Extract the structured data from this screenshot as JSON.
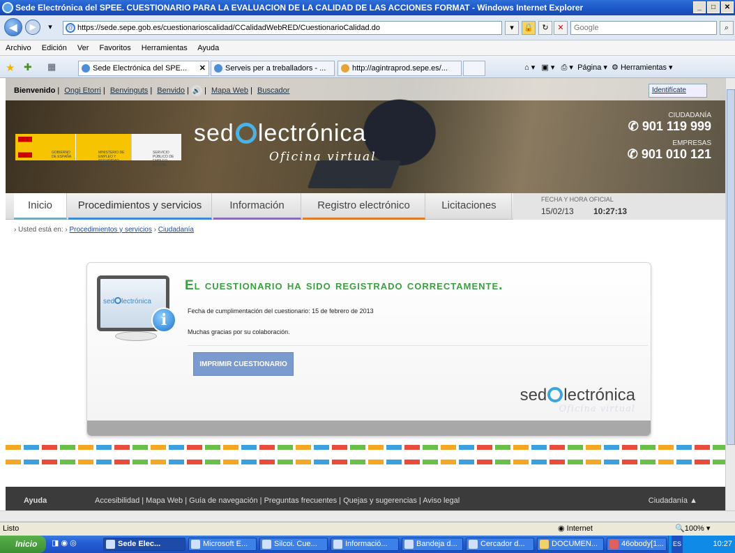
{
  "window": {
    "title": "Sede Electrónica del SPEE. CUESTIONARIO PARA LA EVALUACION DE LA CALIDAD DE LAS ACCIONES FORMAT - Windows Internet Explorer"
  },
  "address": {
    "url": "https://sede.sepe.gob.es/cuestionarioscalidad/CCalidadWebRED/CuestionarioCalidad.do",
    "search_placeholder": "Google"
  },
  "menu": [
    "Archivo",
    "Edición",
    "Ver",
    "Favoritos",
    "Herramientas",
    "Ayuda"
  ],
  "browser_tabs": [
    {
      "label": "Sede Electrónica del SPE...",
      "active": true
    },
    {
      "label": "Serveis per a treballadors - ...",
      "active": false
    },
    {
      "label": "http://agintraprod.sepe.es/...",
      "active": false
    }
  ],
  "toolbar_right": {
    "page": "Página",
    "tools": "Herramientas"
  },
  "header": {
    "welcome": "Bienvenido",
    "langs": [
      "Ongi Etorri",
      "Benvinguts",
      "Benvido"
    ],
    "links": [
      "Mapa Web",
      "Buscador"
    ],
    "identify": "Identifícate",
    "logo_main": "sed",
    "logo_rest": "lectrónica",
    "tagline": "Oficina virtual",
    "gov_1": "GOBIERNO DE ESPAÑA",
    "gov_2": "MINISTERIO DE EMPLEO Y SEGURIDAD SOCIAL",
    "gov_3": "SERVICIO PÚBLICO DE EMPLEO ESTATAL",
    "phone_ciudadania_label": "CIUDADANÍA",
    "phone_ciudadania": "901 119 999",
    "phone_empresas_label": "EMPRESAS",
    "phone_empresas": "901 010 121"
  },
  "nav": {
    "items": [
      "Inicio",
      "Procedimientos y servicios",
      "Información",
      "Registro electrónico",
      "Licitaciones"
    ],
    "clock_label": "FECHA Y HORA OFICIAL",
    "date": "15/02/13",
    "time": "10:27:13"
  },
  "breadcrumb": {
    "prefix": "Usted está en:",
    "items": [
      "Procedimientos y servicios",
      "Ciudadanía"
    ]
  },
  "message": {
    "title": "El cuestionario ha sido registrado correctamente.",
    "date_line": "Fecha de cumplimentación del cuestionario: 15 de febrero de 2013",
    "thanks": "Muchas gracias por su colaboración.",
    "print_button": "IMPRIMIR CUESTIONARIO",
    "monitor_text": "sed"
  },
  "footer": {
    "help": "Ayuda",
    "links": "Accesibilidad | Mapa Web | Guía de navegación | Preguntas frecuentes | Quejas y sugerencias | Aviso legal",
    "right": "Ciudadanía ▲"
  },
  "status": {
    "text": "Listo",
    "zone": "Internet",
    "zoom": "100%"
  },
  "taskbar": {
    "start": "Inicio",
    "items": [
      "Sede Elec...",
      "Microsoft E...",
      "Silcoi. Cue...",
      "Informació...",
      "Bandeja d...",
      "Cercador d...",
      "DOCUMEN...",
      "46obody[1..."
    ],
    "lang": "ES",
    "clock": "10:27"
  },
  "colors": {
    "accent_green": "#3aa040",
    "print_button": "#7b9bd0",
    "logo_e": "#4ab3e6"
  }
}
